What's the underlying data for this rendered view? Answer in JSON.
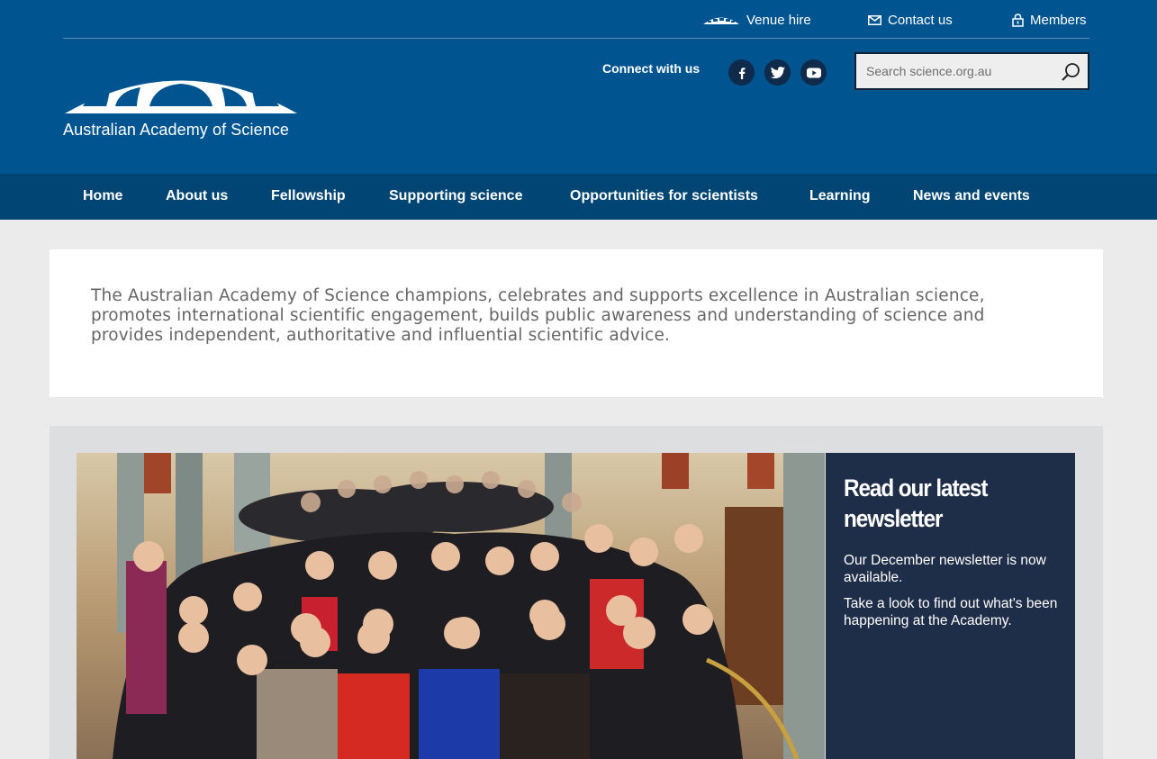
{
  "utility": {
    "venue": "Venue hire",
    "contact": "Contact us",
    "members": "Members"
  },
  "logo": {
    "name": "Australian Academy of Science"
  },
  "connect": {
    "label": "Connect with us",
    "icons": [
      "facebook-icon",
      "twitter-icon",
      "youtube-icon"
    ]
  },
  "search": {
    "placeholder": "Search science.org.au",
    "value": ""
  },
  "nav": [
    "Home",
    "About us",
    "Fellowship",
    "Supporting science",
    "Opportunities for scientists",
    "Learning",
    "News and events"
  ],
  "intro": {
    "text": "The Australian Academy of Science champions, celebrates and supports excellence in Australian science, promotes international scientific engagement, builds public awareness and understanding of science and provides independent, authoritative and influential scientific advice."
  },
  "feature": {
    "heading": "Read our latest newsletter",
    "p1": "Our December newsletter is now available.",
    "p2": "Take a look to find out what's been happening at the Academy."
  },
  "colors": {
    "header": "#005590",
    "nav": "#004574",
    "panel": "#1f2e48",
    "page_bg": "#ebebeb"
  }
}
